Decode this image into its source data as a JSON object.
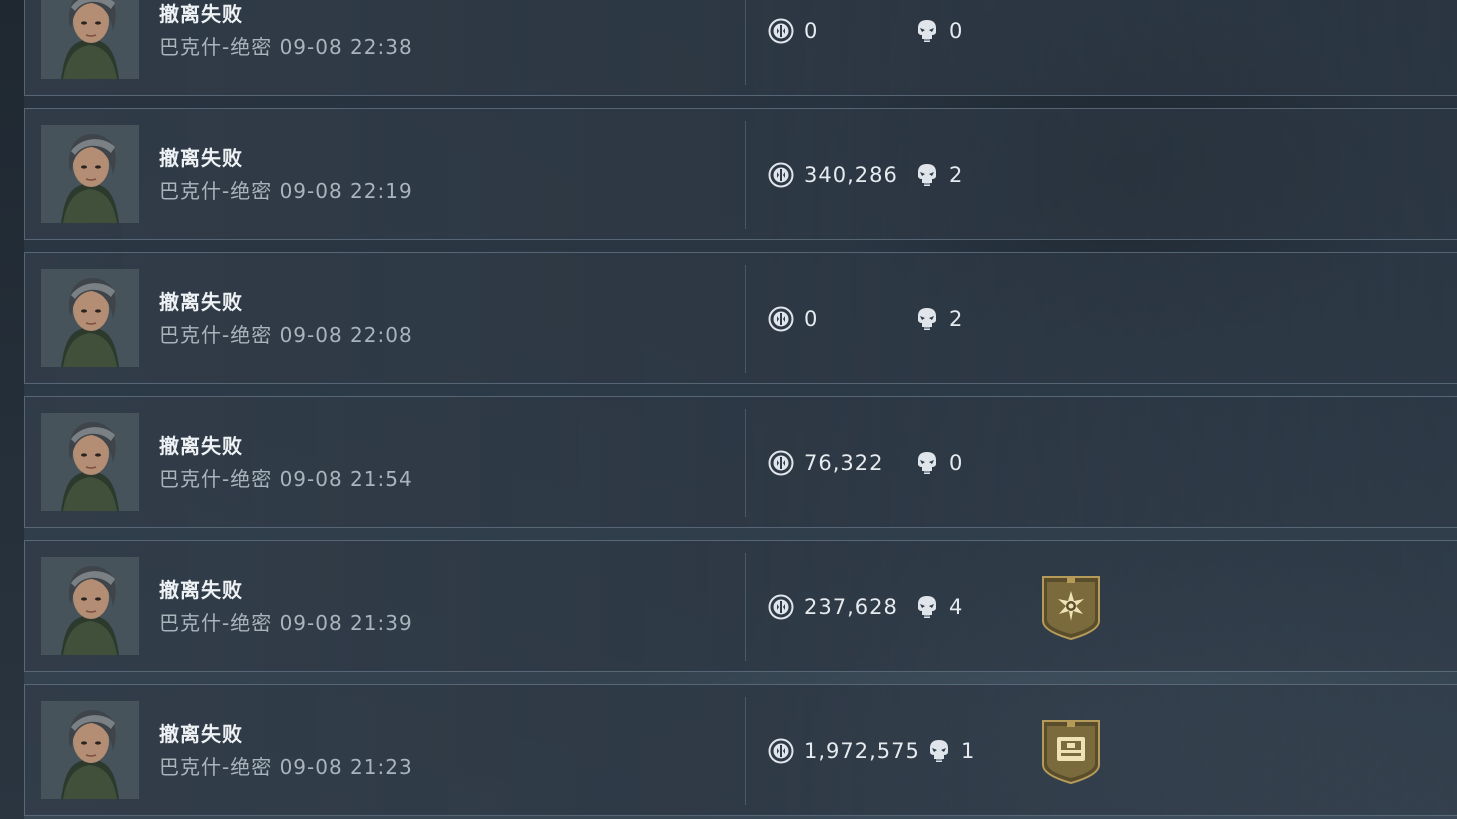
{
  "records": [
    {
      "status": "撤离失败",
      "meta": "巴克什-绝密 09-08 22:38",
      "value": "0",
      "kills": "0",
      "badge": null
    },
    {
      "status": "撤离失败",
      "meta": "巴克什-绝密 09-08 22:19",
      "value": "340,286",
      "kills": "2",
      "badge": null
    },
    {
      "status": "撤离失败",
      "meta": "巴克什-绝密 09-08 22:08",
      "value": "0",
      "kills": "2",
      "badge": null
    },
    {
      "status": "撤离失败",
      "meta": "巴克什-绝密 09-08 21:54",
      "value": "76,322",
      "kills": "0",
      "badge": null
    },
    {
      "status": "撤离失败",
      "meta": "巴克什-绝密 09-08 21:39",
      "value": "237,628",
      "kills": "4",
      "badge": "star-shield-icon"
    },
    {
      "status": "撤离失败",
      "meta": "巴克什-绝密 09-08 21:23",
      "value": "1,972,575",
      "kills": "1",
      "badge": "card-shield-icon"
    }
  ],
  "colors": {
    "badge_gold": "#b59a5a",
    "badge_dark": "#5a4d2c",
    "text_primary": "#eef2f5",
    "text_secondary": "#a9b4bd"
  }
}
